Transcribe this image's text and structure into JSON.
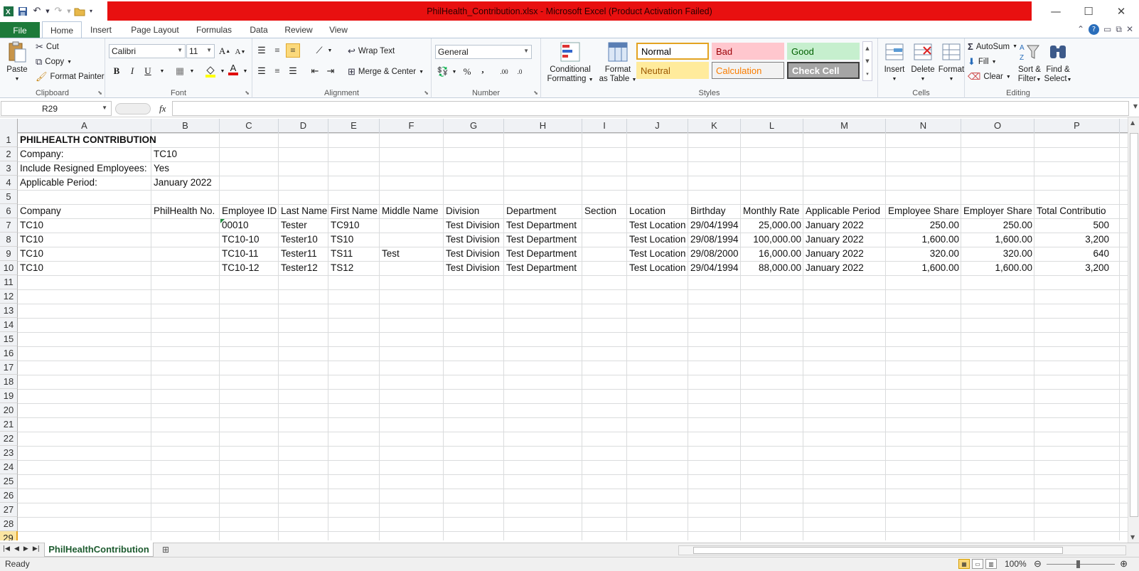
{
  "window": {
    "title": "PhilHealth_Contribution.xlsx - Microsoft Excel (Product Activation Failed)"
  },
  "ribbon_tabs": [
    "File",
    "Home",
    "Insert",
    "Page Layout",
    "Formulas",
    "Data",
    "Review",
    "View"
  ],
  "clipboard": {
    "paste": "Paste",
    "cut": "Cut",
    "copy": "Copy",
    "format_painter": "Format Painter",
    "label": "Clipboard"
  },
  "font": {
    "name": "Calibri",
    "size": "11",
    "label": "Font",
    "bold": "B",
    "italic": "I",
    "underline": "U"
  },
  "alignment": {
    "wrap_text": "Wrap Text",
    "merge_center": "Merge & Center",
    "label": "Alignment"
  },
  "number": {
    "format": "General",
    "percent": "%",
    "comma": ",",
    "label": "Number"
  },
  "styles": {
    "conditional_1": "Conditional",
    "conditional_2": "Formatting",
    "format_table_1": "Format",
    "format_table_2": "as Table",
    "cells": [
      {
        "name": "Normal",
        "bg": "#ffffff",
        "fg": "#000000",
        "border": "#e3a321"
      },
      {
        "name": "Bad",
        "bg": "#ffc7ce",
        "fg": "#9c0006",
        "border": "#ffc7ce"
      },
      {
        "name": "Good",
        "bg": "#c6efce",
        "fg": "#006100",
        "border": "#c6efce"
      },
      {
        "name": "Neutral",
        "bg": "#ffeb9c",
        "fg": "#9c5700",
        "border": "#ffeb9c"
      },
      {
        "name": "Calculation",
        "bg": "#f2f2f2",
        "fg": "#fa7d00",
        "border": "#7f7f7f"
      },
      {
        "name": "Check Cell",
        "bg": "#a5a5a5",
        "fg": "#ffffff",
        "border": "#3f3f3f"
      }
    ],
    "label": "Styles"
  },
  "cells_group": {
    "insert": "Insert",
    "delete": "Delete",
    "format": "Format",
    "label": "Cells"
  },
  "editing": {
    "autosum": "AutoSum",
    "fill": "Fill",
    "clear": "Clear",
    "sort_1": "Sort &",
    "sort_2": "Filter",
    "find_1": "Find &",
    "find_2": "Select",
    "label": "Editing"
  },
  "formula_bar": {
    "name_box": "R29",
    "fx": "fx",
    "content": ""
  },
  "columns": [
    "A",
    "B",
    "C",
    "D",
    "E",
    "F",
    "G",
    "H",
    "I",
    "J",
    "K",
    "L",
    "M",
    "N",
    "O",
    "P"
  ],
  "rows": [
    "1",
    "2",
    "3",
    "4",
    "5",
    "6",
    "7",
    "8",
    "9",
    "10",
    "11",
    "12",
    "13",
    "14",
    "15",
    "16",
    "17",
    "18",
    "19",
    "20",
    "21",
    "22",
    "23",
    "24",
    "25",
    "26",
    "27",
    "28",
    "29"
  ],
  "sheet": {
    "title": "PHILHEALTH CONTRIBUTION",
    "meta": [
      {
        "label": "Company:",
        "value": "TC10"
      },
      {
        "label": "Include Resigned Employees:",
        "value": "Yes"
      },
      {
        "label": "Applicable Period:",
        "value": "January 2022"
      }
    ],
    "headers": [
      "Company",
      "PhilHealth No.",
      "Employee ID",
      "Last Name",
      "First Name",
      "Middle Name",
      "Division",
      "Department",
      "Section",
      "Location",
      "Birthday",
      "Monthly Rate",
      "Applicable Period",
      "Employee Share",
      "Employer Share",
      "Total Contributio"
    ],
    "records": [
      [
        "TC10",
        "",
        "00010",
        "Tester",
        "TC910",
        "",
        "Test Division",
        "Test Department",
        "",
        "Test Location",
        "29/04/1994",
        "25,000.00",
        "January 2022",
        "250.00",
        "250.00",
        "500"
      ],
      [
        "TC10",
        "",
        "TC10-10",
        "Tester10",
        "TS10",
        "",
        "Test Division",
        "Test Department",
        "",
        "Test Location",
        "29/08/1994",
        "100,000.00",
        "January 2022",
        "1,600.00",
        "1,600.00",
        "3,200"
      ],
      [
        "TC10",
        "",
        "TC10-11",
        "Tester11",
        "TS11",
        "Test",
        "Test Division",
        "Test Department",
        "",
        "Test Location",
        "29/08/2000",
        "16,000.00",
        "January 2022",
        "320.00",
        "320.00",
        "640"
      ],
      [
        "TC10",
        "",
        "TC10-12",
        "Tester12",
        "TS12",
        "",
        "Test Division",
        "Test Department",
        "",
        "Test Location",
        "29/04/1994",
        "88,000.00",
        "January 2022",
        "1,600.00",
        "1,600.00",
        "3,200"
      ]
    ]
  },
  "sheet_tab": "PhilHealthContribution",
  "status": {
    "ready": "Ready",
    "zoom": "100%"
  }
}
